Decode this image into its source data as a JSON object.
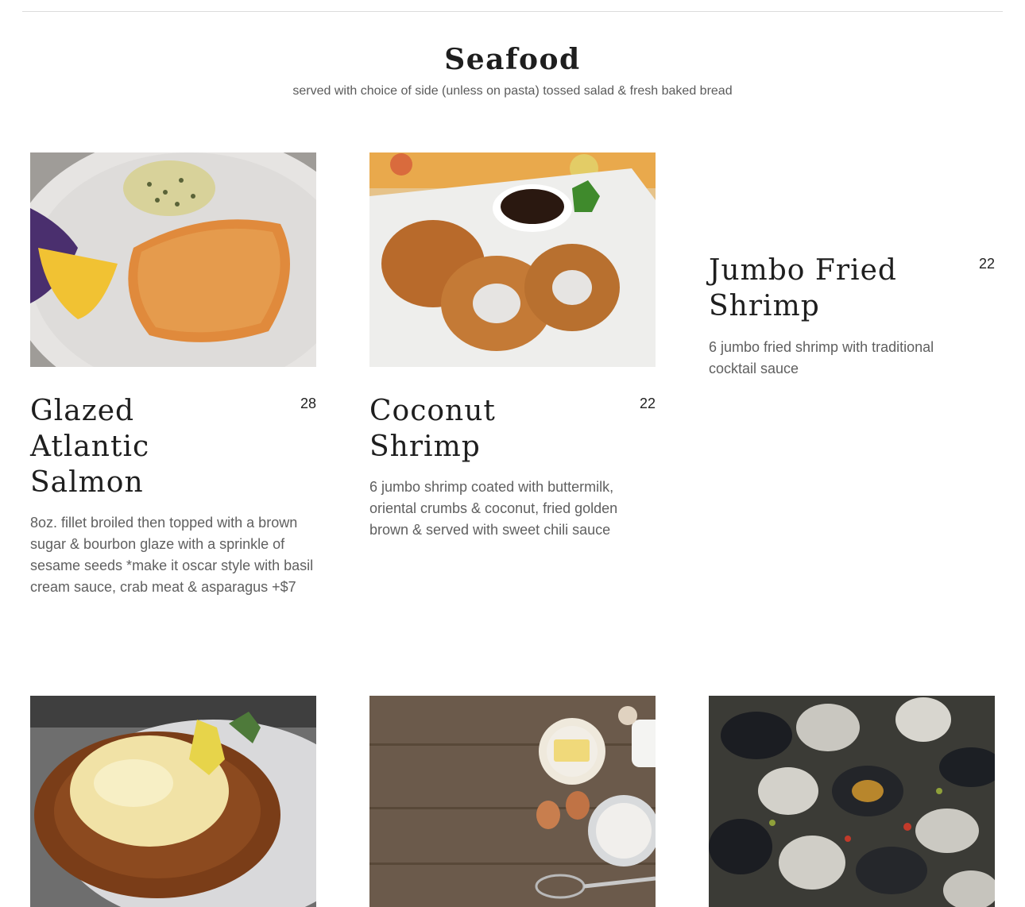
{
  "section": {
    "title": "Seafood",
    "subtitle": "served with choice of side (unless on pasta) tossed salad & fresh baked bread"
  },
  "items": [
    {
      "name": "Glazed Atlantic Salmon",
      "price": "28",
      "description": "8oz. fillet broiled then topped with a brown sugar & bourbon glaze with a sprinkle of sesame seeds *make it oscar style with basil cream sauce, crab meat & asparagus +$7"
    },
    {
      "name": "Coconut Shrimp",
      "price": "22",
      "description": "6 jumbo shrimp coated with buttermilk, oriental crumbs & coconut, fried golden brown & served with sweet chili sauce"
    },
    {
      "name": "Jumbo Fried Shrimp",
      "price": "22",
      "description": "6 jumbo fried shrimp with traditional cocktail sauce"
    }
  ],
  "colors": {
    "title": "#1e1e1e",
    "body_text": "#5f5f5f",
    "divider": "#dcdcdc"
  }
}
